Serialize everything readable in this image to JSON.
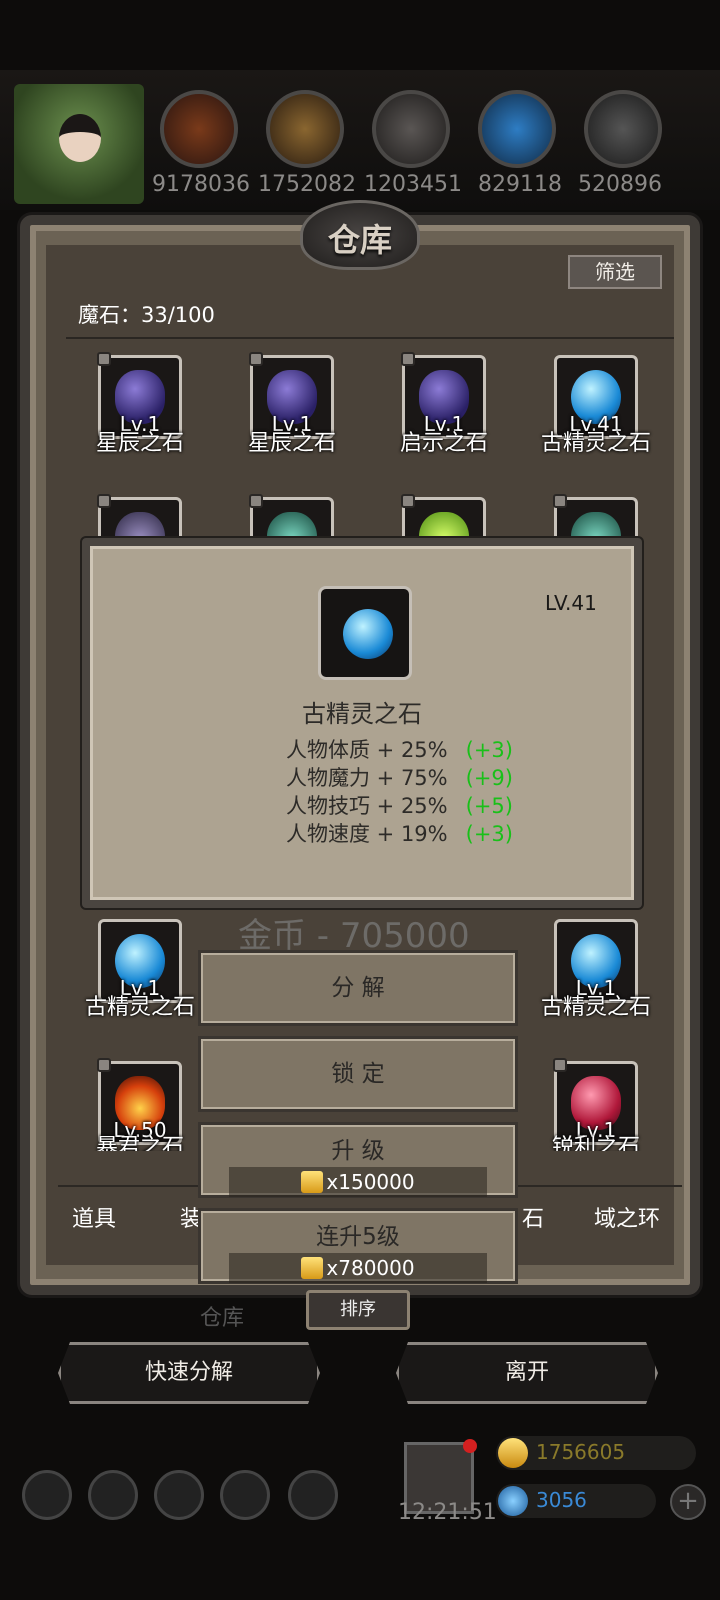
{
  "resources": [
    {
      "icon": "ore-icon",
      "value": "9178036"
    },
    {
      "icon": "wood-icon",
      "value": "1752082"
    },
    {
      "icon": "stone-icon",
      "value": "1203451"
    },
    {
      "icon": "crystal-icon",
      "value": "829118"
    },
    {
      "icon": "iron-icon",
      "value": "520896"
    }
  ],
  "panel": {
    "title": "仓库",
    "filter_label": "筛选",
    "stone_count": "魔石：33/100"
  },
  "grid": {
    "row1": [
      {
        "name": "星辰之石",
        "level": "Lv.1",
        "gem": "purple",
        "locked": true
      },
      {
        "name": "星辰之石",
        "level": "Lv.1",
        "gem": "purple",
        "locked": true
      },
      {
        "name": "启示之石",
        "level": "Lv.1",
        "gem": "purple",
        "locked": true
      },
      {
        "name": "古精灵之石",
        "level": "Lv.41",
        "gem": "blue",
        "locked": false
      }
    ],
    "row4": [
      {
        "name": "古精灵之石",
        "level": "Lv.1",
        "gem": "blue",
        "locked": false
      },
      {
        "name": "古精灵之石",
        "level": "Lv.1",
        "gem": "blue",
        "locked": false
      }
    ],
    "row5": [
      {
        "name": "暴君之石",
        "level": "Lv.50",
        "gem": "fire",
        "locked": true
      },
      {
        "name": "锐利之石",
        "level": "Lv.1",
        "gem": "red",
        "locked": true
      }
    ]
  },
  "tabs": {
    "items": "道具",
    "equip": "装",
    "stone": "石",
    "ring": "域之环"
  },
  "detail_card": {
    "level": "LV.41",
    "name": "古精灵之石",
    "stats": [
      {
        "label": "人物体质 + 25%",
        "bonus": "(+3)"
      },
      {
        "label": "人物魔力 + 75%",
        "bonus": "(+9)"
      },
      {
        "label": "人物技巧 + 25%",
        "bonus": "(+5)"
      },
      {
        "label": "人物速度 + 19%",
        "bonus": "(+3)"
      }
    ]
  },
  "gold_text": "金币 - 705000",
  "actions": {
    "decompose": "分 解",
    "lock": "锁 定",
    "upgrade": "升 级",
    "upgrade_cost": "x150000",
    "upgrade5": "连升5级",
    "upgrade5_cost": "x780000"
  },
  "sort_label": "排序",
  "behind_text": "仓库",
  "bottom": {
    "quick_decompose": "快速分解",
    "leave": "离开"
  },
  "footer": {
    "clock": "12:21:51",
    "gold": "1756605",
    "gems": "3056",
    "plus": "+"
  },
  "colors": {
    "bonus_green": "#19c019",
    "gold_text": "#8a7a2a",
    "gem_text": "#3a8ad6"
  }
}
